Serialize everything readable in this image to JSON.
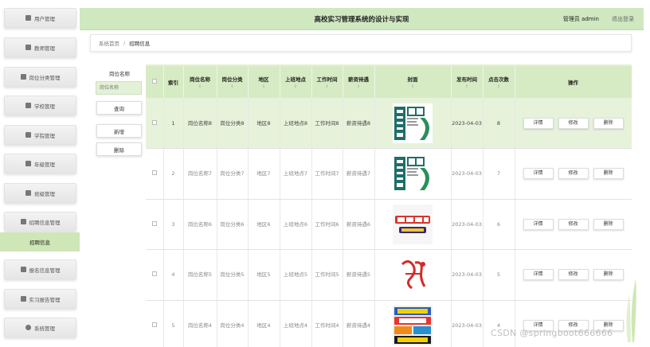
{
  "header": {
    "title": "高校实习管理系统的设计与实现",
    "user": "管理员 admin",
    "logout": "退出登录"
  },
  "sidebar": {
    "items": [
      {
        "label": "用户管理",
        "icon": "users-icon"
      },
      {
        "label": "教师管理",
        "icon": "grid-icon"
      },
      {
        "label": "岗位分类管理",
        "icon": "grid-icon"
      },
      {
        "label": "学校管理",
        "icon": "grid-icon"
      },
      {
        "label": "学院管理",
        "icon": "grid-icon"
      },
      {
        "label": "年级管理",
        "icon": "list-icon"
      },
      {
        "label": "班级管理",
        "icon": "grid-icon"
      },
      {
        "label": "招聘信息管理",
        "icon": "calendar-icon"
      },
      {
        "label": "报名信息管理",
        "icon": "grid-icon"
      },
      {
        "label": "实习报告管理",
        "icon": "send-icon"
      },
      {
        "label": "系统管理",
        "icon": "bulb-icon"
      }
    ],
    "active_sub": "招聘信息"
  },
  "breadcrumb": {
    "home": "系统首页",
    "sep": "/",
    "current": "招聘信息"
  },
  "search": {
    "label": "岗位名称",
    "placeholder": "岗位名称",
    "query_button": "查询",
    "add_button": "新增",
    "delete_button": "删除"
  },
  "table": {
    "headers": [
      "索引",
      "岗位名称",
      "岗位分类",
      "地区",
      "上班地点",
      "工作时间",
      "薪资待遇",
      "封面",
      "发布时间",
      "点击次数",
      "操作"
    ],
    "rows": [
      {
        "index": "1",
        "name": "岗位名称8",
        "category": "岗位分类8",
        "region": "地区8",
        "location": "上班地点8",
        "hours": "工作时间8",
        "salary": "薪资待遇8",
        "cover": "zhaopin-green",
        "date": "2023-04-03",
        "clicks": "8"
      },
      {
        "index": "2",
        "name": "岗位名称7",
        "category": "岗位分类7",
        "region": "地区7",
        "location": "上班地点7",
        "hours": "工作时间7",
        "salary": "薪资待遇7",
        "cover": "zhaopin-green",
        "date": "2023-04-03",
        "clicks": "7"
      },
      {
        "index": "3",
        "name": "岗位名称6",
        "category": "岗位分类6",
        "region": "地区6",
        "location": "上班地点6",
        "hours": "工作时间6",
        "salary": "薪资待遇6",
        "cover": "chengpin-yingcai",
        "date": "2023-04-03",
        "clicks": "6"
      },
      {
        "index": "4",
        "name": "岗位名称5",
        "category": "岗位分类5",
        "region": "地区5",
        "location": "上班地点5",
        "hours": "工作时间5",
        "salary": "薪资待遇5",
        "cover": "zhaopin-red",
        "date": "2023-04-03",
        "clicks": "5"
      },
      {
        "index": "5",
        "name": "岗位名称4",
        "category": "岗位分类4",
        "region": "地区4",
        "location": "上班地点4",
        "hours": "工作时间4",
        "salary": "薪资待遇4",
        "cover": "zhaopin-haibao",
        "date": "2023-04-03",
        "clicks": "4"
      }
    ],
    "op_labels": {
      "detail": "详情",
      "edit": "修改",
      "delete": "删除"
    }
  },
  "watermark": "CSDN @springboot666666",
  "colors": {
    "accent": "#cfe8bf",
    "header_row": "#d6ebc4",
    "highlight_row": "#e6f2da"
  }
}
